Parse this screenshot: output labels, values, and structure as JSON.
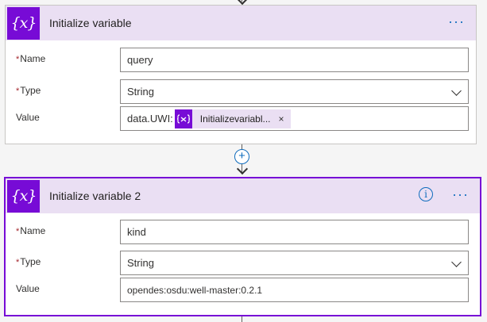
{
  "card1": {
    "icon": "{x}",
    "title": "Initialize variable",
    "more": "···",
    "fields": {
      "name_label": "Name",
      "name_value": "query",
      "type_label": "Type",
      "type_value": "String",
      "value_label": "Value",
      "value_prefix": "data.UWI:",
      "token_label": "Initializevariabl...",
      "token_close": "×"
    }
  },
  "card2": {
    "icon": "{x}",
    "title": "Initialize variable 2",
    "info": "i",
    "more": "···",
    "fields": {
      "name_label": "Name",
      "name_value": "kind",
      "type_label": "Type",
      "type_value": "String",
      "value_label": "Value",
      "value_text": "opendes:osdu:well-master:0.2.1"
    }
  },
  "connector": {
    "add_symbol": "+"
  },
  "required_marker": "*",
  "colors": {
    "accent": "#770bd6",
    "header_bg": "#eadff3",
    "link_blue": "#0f6cbd",
    "required_red": "#a4262c"
  }
}
